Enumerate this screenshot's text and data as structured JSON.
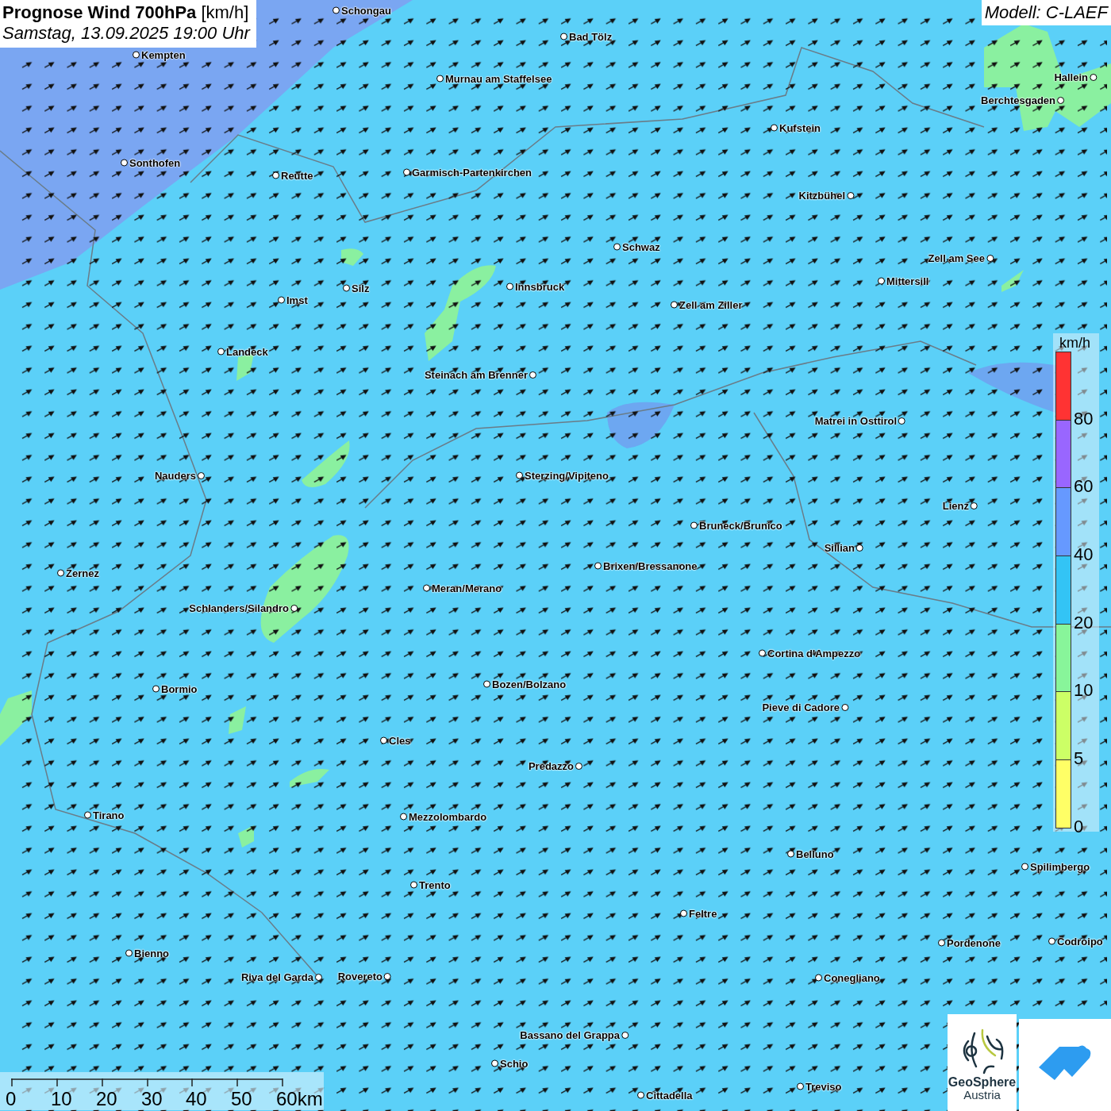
{
  "header": {
    "title": "**Prognose Wind 700hPa** [km/h]",
    "subtitle": "Samstag, 13.09.2025 19:00 Uhr"
  },
  "model": "Modell: C-LAEF",
  "cities": [
    "Schongau",
    "Bad Tölz",
    "Kempten",
    "Murnau am Staffelsee",
    "Hallein",
    "Berchtesgaden",
    "Kufstein",
    "Sonthofen",
    "Reutte",
    "Garmisch-Partenkirchen",
    "Kitzbühel",
    "Schwaz",
    "Zell am See",
    "Mittersill",
    "Innsbruck",
    "Imst",
    "Silz",
    "Zell am Ziller",
    "Landeck",
    "Steinach am Brenner",
    "Matrei in Osttirol",
    "Nauders",
    "Sterzing/Vipiteno",
    "Lienz",
    "Bruneck/Brunico",
    "Sillian",
    "Brixen/Bressanone",
    "Zernez",
    "Meran/Merano",
    "Schlanders/Silandro",
    "Cortina d'Ampezzo",
    "Bozen/Bolzano",
    "Bormio",
    "Pieve di Cadore",
    "Cles",
    "Predazzo",
    "Tirano",
    "Mezzolombardo",
    "Belluno",
    "Spilimbergo",
    "Trento",
    "Feltre",
    "Pordenone",
    "Codroipo",
    "Bienno",
    "Riva del Garda",
    "Rovereto",
    "Conegliano",
    "Bassano del Grappa",
    "Schio",
    "Treviso",
    "Cittadella"
  ],
  "legend": {
    "unit": "km/h",
    "bins": [
      {
        "color": "#ff3333"
      },
      {
        "color": "#9966ff"
      },
      {
        "color": "#6699ff"
      },
      {
        "color": "#33c4f5"
      },
      {
        "color": "#88f59a"
      },
      {
        "color": "#ccff66"
      },
      {
        "color": "#ffff66"
      }
    ],
    "ticks": [
      "80",
      "60",
      "40",
      "20",
      "10",
      "5",
      "0"
    ]
  },
  "scale": {
    "ticks": [
      "0",
      "10",
      "20",
      "30",
      "40",
      "50",
      "60km"
    ]
  },
  "logos": {
    "name": "GeoSphere",
    "sub": "Austria"
  }
}
